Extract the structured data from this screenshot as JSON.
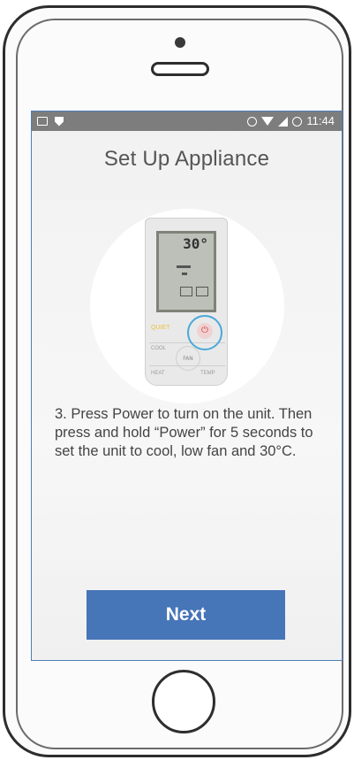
{
  "status_bar": {
    "time": "11:44",
    "left_icons": [
      "image-icon",
      "shield-icon"
    ],
    "right_icons": [
      "alarm-icon",
      "wifi-icon",
      "signal-icon",
      "circle-badge-icon"
    ]
  },
  "screen": {
    "title": "Set Up Appliance",
    "instruction": "3. Press Power to turn on the unit. Then press and hold “Power” for 5 seconds to set the unit to cool, low fan and 30°C.",
    "next_label": "Next"
  },
  "remote": {
    "lcd_temp": "30°",
    "quiet_label": "QUIET",
    "cool_label": "COOL",
    "fan_label": "FAN",
    "heat_label": "HEAT",
    "temp_label": "TEMP",
    "power_symbol": "⏻"
  },
  "colors": {
    "accent": "#4675b8",
    "highlight_ring": "#4aa9d8",
    "status_bar": "#7d7d7d"
  }
}
